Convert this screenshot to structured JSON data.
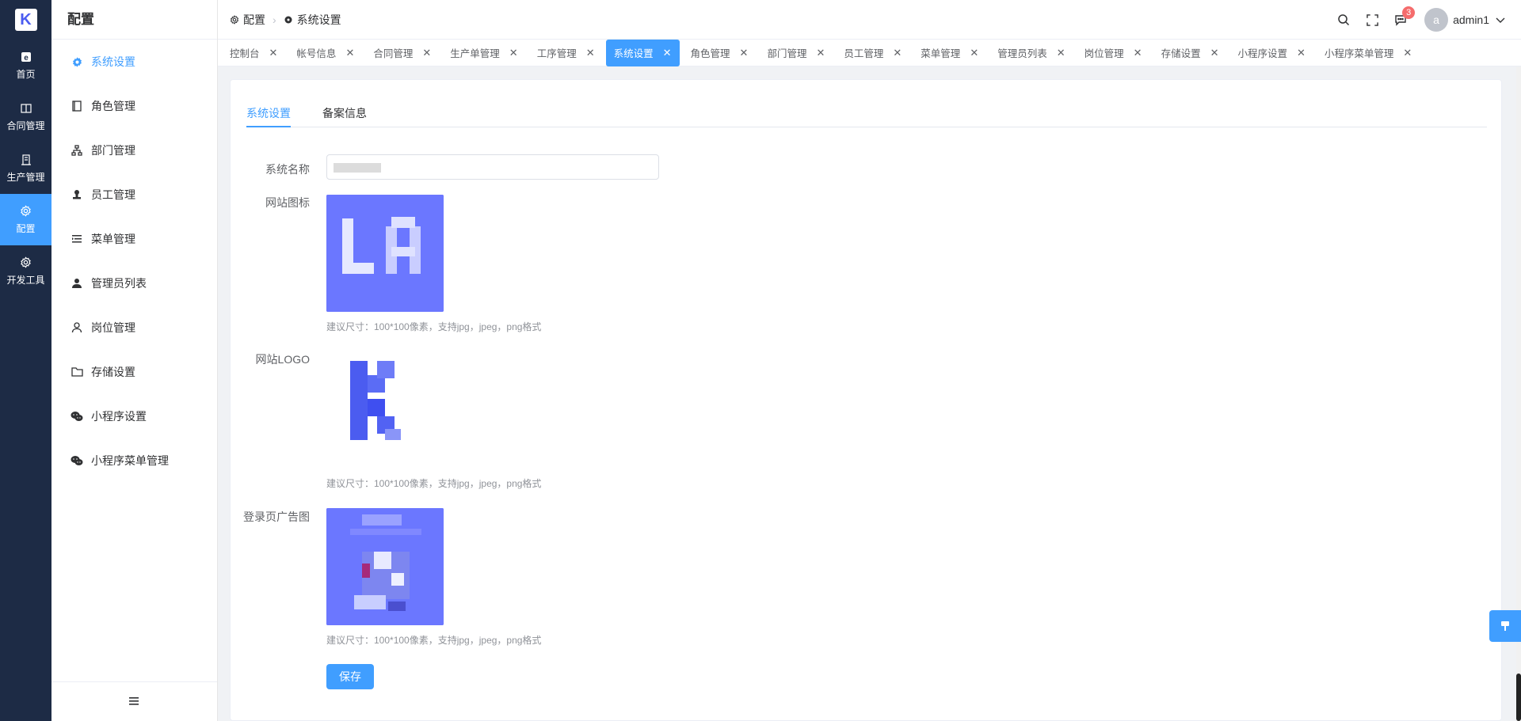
{
  "rail": {
    "items": [
      {
        "label": "首页",
        "icon": "home-icon"
      },
      {
        "label": "合同管理",
        "icon": "book-icon"
      },
      {
        "label": "生产管理",
        "icon": "building-icon"
      },
      {
        "label": "配置",
        "icon": "gear-icon"
      },
      {
        "label": "开发工具",
        "icon": "gear-icon"
      }
    ],
    "active_index": 3
  },
  "submenu": {
    "title": "配置",
    "items": [
      {
        "label": "系统设置",
        "icon": "gear-icon"
      },
      {
        "label": "角色管理",
        "icon": "notebook-icon"
      },
      {
        "label": "部门管理",
        "icon": "org-chart-icon"
      },
      {
        "label": "员工管理",
        "icon": "stamp-icon"
      },
      {
        "label": "菜单管理",
        "icon": "list-indent-icon"
      },
      {
        "label": "管理员列表",
        "icon": "user-filled-icon"
      },
      {
        "label": "岗位管理",
        "icon": "user-outline-icon"
      },
      {
        "label": "存储设置",
        "icon": "folder-icon"
      },
      {
        "label": "小程序设置",
        "icon": "wechat-icon"
      },
      {
        "label": "小程序菜单管理",
        "icon": "wechat-icon"
      }
    ],
    "active_index": 0
  },
  "header": {
    "breadcrumb": [
      "配置",
      "系统设置"
    ],
    "notification_count": "3",
    "avatar_letter": "a",
    "username": "admin1"
  },
  "tabs": [
    {
      "label": "控制台"
    },
    {
      "label": "帐号信息"
    },
    {
      "label": "合同管理"
    },
    {
      "label": "生产单管理"
    },
    {
      "label": "工序管理"
    },
    {
      "label": "系统设置"
    },
    {
      "label": "角色管理"
    },
    {
      "label": "部门管理"
    },
    {
      "label": "员工管理"
    },
    {
      "label": "菜单管理"
    },
    {
      "label": "管理员列表"
    },
    {
      "label": "岗位管理"
    },
    {
      "label": "存储设置"
    },
    {
      "label": "小程序设置"
    },
    {
      "label": "小程序菜单管理"
    }
  ],
  "form": {
    "tabs": [
      "系统设置",
      "备案信息"
    ],
    "system_name_label": "系统名称",
    "favicon_label": "网站图标",
    "logo_label": "网站LOGO",
    "login_ad_label": "登录页广告图",
    "hint": "建议尺寸：100*100像素，支持jpg，jpeg，png格式",
    "save_label": "保存"
  },
  "colors": {
    "primary": "#409eff",
    "rail_bg": "#1d2b45",
    "image_blue": "#6b77ff",
    "badge": "#f56c6c"
  }
}
